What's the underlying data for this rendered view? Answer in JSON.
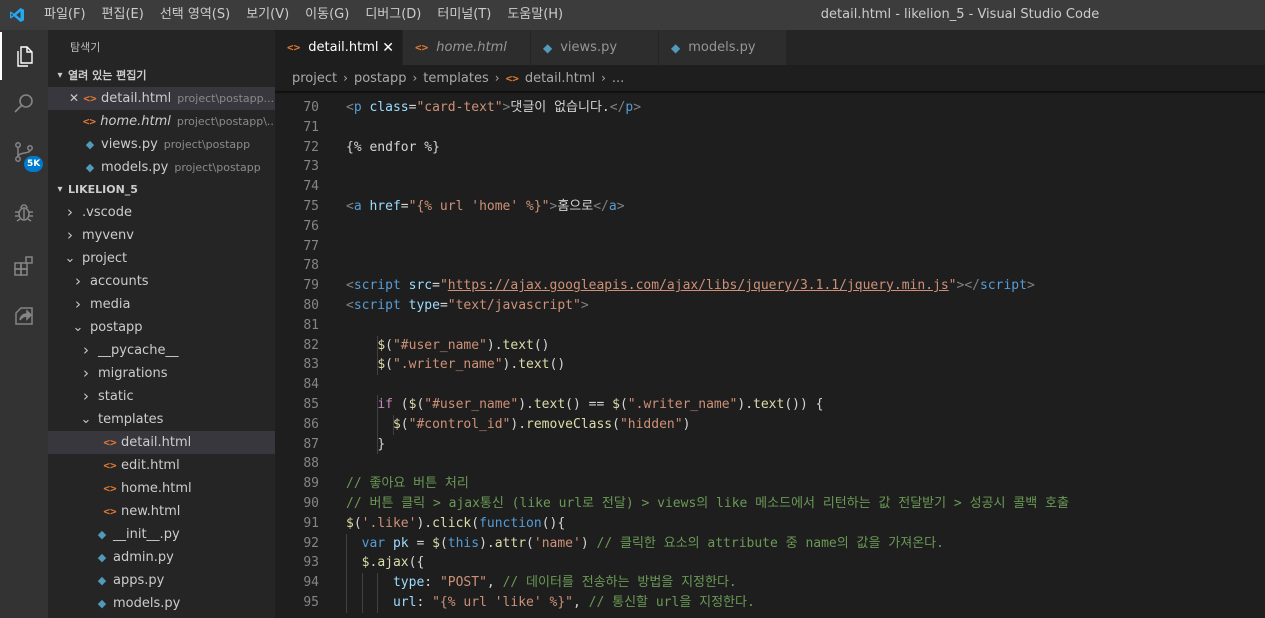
{
  "titlebar": {
    "menu": [
      "파일(F)",
      "편집(E)",
      "선택 영역(S)",
      "보기(V)",
      "이동(G)",
      "디버그(D)",
      "터미널(T)",
      "도움말(H)"
    ],
    "title": "detail.html - likelion_5 - Visual Studio Code"
  },
  "activity": {
    "scm_badge": "5K",
    "icons": [
      "explorer-icon",
      "search-icon",
      "source-control-icon",
      "debug-icon",
      "extensions-icon",
      "remote-explorer-icon"
    ]
  },
  "sidebar": {
    "title": "탐색기",
    "open_editors": {
      "header": "열려 있는 편집기",
      "items": [
        {
          "name": "detail.html",
          "path": "project\\postapp...",
          "type": "html",
          "italic": false,
          "selected": true
        },
        {
          "name": "home.html",
          "path": "project\\postapp\\...",
          "type": "html",
          "italic": true,
          "selected": false
        },
        {
          "name": "views.py",
          "path": "project\\postapp",
          "type": "py",
          "italic": false,
          "selected": false
        },
        {
          "name": "models.py",
          "path": "project\\postapp",
          "type": "py",
          "italic": false,
          "selected": false
        }
      ]
    },
    "workspace": {
      "header": "LIKELION_5",
      "tree": [
        {
          "name": ".vscode",
          "kind": "folder",
          "open": false,
          "depth": 0
        },
        {
          "name": "myvenv",
          "kind": "folder",
          "open": false,
          "depth": 0
        },
        {
          "name": "project",
          "kind": "folder",
          "open": true,
          "depth": 0
        },
        {
          "name": "accounts",
          "kind": "folder",
          "open": false,
          "depth": 1
        },
        {
          "name": "media",
          "kind": "folder",
          "open": false,
          "depth": 1
        },
        {
          "name": "postapp",
          "kind": "folder",
          "open": true,
          "depth": 1
        },
        {
          "name": "__pycache__",
          "kind": "folder",
          "open": false,
          "depth": 2
        },
        {
          "name": "migrations",
          "kind": "folder",
          "open": false,
          "depth": 2
        },
        {
          "name": "static",
          "kind": "folder",
          "open": false,
          "depth": 2
        },
        {
          "name": "templates",
          "kind": "folder",
          "open": true,
          "depth": 2
        },
        {
          "name": "detail.html",
          "kind": "html",
          "depth": 3,
          "selected": true
        },
        {
          "name": "edit.html",
          "kind": "html",
          "depth": 3
        },
        {
          "name": "home.html",
          "kind": "html",
          "depth": 3
        },
        {
          "name": "new.html",
          "kind": "html",
          "depth": 3
        },
        {
          "name": "__init__.py",
          "kind": "py",
          "depth": 2
        },
        {
          "name": "admin.py",
          "kind": "py",
          "depth": 2
        },
        {
          "name": "apps.py",
          "kind": "py",
          "depth": 2
        },
        {
          "name": "models.py",
          "kind": "py",
          "depth": 2
        }
      ]
    }
  },
  "tabs": [
    {
      "name": "detail.html",
      "type": "html",
      "active": true,
      "italic": false,
      "close": "✕"
    },
    {
      "name": "home.html",
      "type": "html",
      "active": false,
      "italic": true
    },
    {
      "name": "views.py",
      "type": "py",
      "active": false,
      "italic": false
    },
    {
      "name": "models.py",
      "type": "py",
      "active": false,
      "italic": false
    }
  ],
  "breadcrumbs": [
    "project",
    "postapp",
    "templates",
    "detail.html",
    "..."
  ],
  "editor": {
    "lines": [
      {
        "n": "70",
        "indent": 0,
        "tokens": [
          [
            "t-br",
            "<"
          ],
          [
            "t-tag",
            "p"
          ],
          [
            "t-txt",
            " "
          ],
          [
            "t-attr",
            "class"
          ],
          [
            "t-txt",
            "="
          ],
          [
            "t-str",
            "\"card-text\""
          ],
          [
            "t-br",
            ">"
          ],
          [
            "t-txt",
            "댓글이 없습니다."
          ],
          [
            "t-br",
            "</"
          ],
          [
            "t-tag",
            "p"
          ],
          [
            "t-br",
            ">"
          ]
        ]
      },
      {
        "n": "71",
        "indent": 0,
        "tokens": []
      },
      {
        "n": "72",
        "indent": 0,
        "tokens": [
          [
            "t-txt",
            "{% endfor %}"
          ]
        ]
      },
      {
        "n": "73",
        "indent": 0,
        "tokens": []
      },
      {
        "n": "74",
        "indent": 0,
        "tokens": []
      },
      {
        "n": "75",
        "indent": 0,
        "tokens": [
          [
            "t-br",
            "<"
          ],
          [
            "t-tag",
            "a"
          ],
          [
            "t-txt",
            " "
          ],
          [
            "t-attr",
            "href"
          ],
          [
            "t-txt",
            "="
          ],
          [
            "t-str",
            "\"{% url 'home' %}\""
          ],
          [
            "t-br",
            ">"
          ],
          [
            "t-txt",
            "홈으로"
          ],
          [
            "t-br",
            "</"
          ],
          [
            "t-tag",
            "a"
          ],
          [
            "t-br",
            ">"
          ]
        ]
      },
      {
        "n": "76",
        "indent": 0,
        "tokens": []
      },
      {
        "n": "77",
        "indent": 0,
        "tokens": []
      },
      {
        "n": "78",
        "indent": 0,
        "tokens": []
      },
      {
        "n": "79",
        "indent": 0,
        "tokens": [
          [
            "t-br",
            "<"
          ],
          [
            "t-tag",
            "script"
          ],
          [
            "t-txt",
            " "
          ],
          [
            "t-attr",
            "src"
          ],
          [
            "t-txt",
            "="
          ],
          [
            "t-str",
            "\""
          ],
          [
            "t-url",
            "https://ajax.googleapis.com/ajax/libs/jquery/3.1.1/jquery.min.js"
          ],
          [
            "t-str",
            "\""
          ],
          [
            "t-br",
            "></"
          ],
          [
            "t-tag",
            "script"
          ],
          [
            "t-br",
            ">"
          ]
        ]
      },
      {
        "n": "80",
        "indent": 0,
        "tokens": [
          [
            "t-br",
            "<"
          ],
          [
            "t-tag",
            "script"
          ],
          [
            "t-txt",
            " "
          ],
          [
            "t-attr",
            "type"
          ],
          [
            "t-txt",
            "="
          ],
          [
            "t-str",
            "\"text/javascript\""
          ],
          [
            "t-br",
            ">"
          ]
        ]
      },
      {
        "n": "81",
        "indent": 0,
        "tokens": []
      },
      {
        "n": "82",
        "indent": 4,
        "tokens": [
          [
            "t-fn",
            "$"
          ],
          [
            "t-txt",
            "("
          ],
          [
            "t-str",
            "\"#user_name\""
          ],
          [
            "t-txt",
            ")."
          ],
          [
            "t-fn",
            "text"
          ],
          [
            "t-txt",
            "()"
          ]
        ]
      },
      {
        "n": "83",
        "indent": 4,
        "tokens": [
          [
            "t-fn",
            "$"
          ],
          [
            "t-txt",
            "("
          ],
          [
            "t-str",
            "\".writer_name\""
          ],
          [
            "t-txt",
            ")."
          ],
          [
            "t-fn",
            "text"
          ],
          [
            "t-txt",
            "()"
          ]
        ]
      },
      {
        "n": "84",
        "indent": 0,
        "tokens": []
      },
      {
        "n": "85",
        "indent": 4,
        "tokens": [
          [
            "t-kw",
            "if"
          ],
          [
            "t-txt",
            " ("
          ],
          [
            "t-fn",
            "$"
          ],
          [
            "t-txt",
            "("
          ],
          [
            "t-str",
            "\"#user_name\""
          ],
          [
            "t-txt",
            ")."
          ],
          [
            "t-fn",
            "text"
          ],
          [
            "t-txt",
            "() == "
          ],
          [
            "t-fn",
            "$"
          ],
          [
            "t-txt",
            "("
          ],
          [
            "t-str",
            "\".writer_name\""
          ],
          [
            "t-txt",
            ")."
          ],
          [
            "t-fn",
            "text"
          ],
          [
            "t-txt",
            "()) {"
          ]
        ]
      },
      {
        "n": "86",
        "indent": 6,
        "tokens": [
          [
            "t-fn",
            "$"
          ],
          [
            "t-txt",
            "("
          ],
          [
            "t-str",
            "\"#control_id\""
          ],
          [
            "t-txt",
            ")."
          ],
          [
            "t-fn",
            "removeClass"
          ],
          [
            "t-txt",
            "("
          ],
          [
            "t-str",
            "\"hidden\""
          ],
          [
            "t-txt",
            ")"
          ]
        ]
      },
      {
        "n": "87",
        "indent": 4,
        "tokens": [
          [
            "t-txt",
            "}"
          ]
        ]
      },
      {
        "n": "88",
        "indent": 0,
        "tokens": []
      },
      {
        "n": "89",
        "indent": 0,
        "tokens": [
          [
            "t-com",
            "// 좋아요 버튼 처리"
          ]
        ]
      },
      {
        "n": "90",
        "indent": 0,
        "tokens": [
          [
            "t-com",
            "// 버튼 클릭 > ajax통신 (like url로 전달) > views의 like 메소드에서 리턴하는 값 전달받기 > 성공시 콜백 호출"
          ]
        ]
      },
      {
        "n": "91",
        "indent": 0,
        "tokens": [
          [
            "t-fn",
            "$"
          ],
          [
            "t-txt",
            "("
          ],
          [
            "t-str",
            "'.like'"
          ],
          [
            "t-txt",
            ")."
          ],
          [
            "t-fn",
            "click"
          ],
          [
            "t-txt",
            "("
          ],
          [
            "t-kwb",
            "function"
          ],
          [
            "t-txt",
            "(){"
          ]
        ]
      },
      {
        "n": "92",
        "indent": 2,
        "tokens": [
          [
            "t-kwb",
            "var"
          ],
          [
            "t-txt",
            " "
          ],
          [
            "t-attr",
            "pk"
          ],
          [
            "t-txt",
            " = "
          ],
          [
            "t-fn",
            "$"
          ],
          [
            "t-txt",
            "("
          ],
          [
            "t-kwb",
            "this"
          ],
          [
            "t-txt",
            ")."
          ],
          [
            "t-fn",
            "attr"
          ],
          [
            "t-txt",
            "("
          ],
          [
            "t-str",
            "'name'"
          ],
          [
            "t-txt",
            ") "
          ],
          [
            "t-com",
            "// 클릭한 요소의 attribute 중 name의 값을 가져온다."
          ]
        ]
      },
      {
        "n": "93",
        "indent": 2,
        "tokens": [
          [
            "t-fn",
            "$"
          ],
          [
            "t-txt",
            "."
          ],
          [
            "t-fn",
            "ajax"
          ],
          [
            "t-txt",
            "({"
          ]
        ]
      },
      {
        "n": "94",
        "indent": 6,
        "tokens": [
          [
            "t-attr",
            "type"
          ],
          [
            "t-txt",
            ": "
          ],
          [
            "t-str",
            "\"POST\""
          ],
          [
            "t-txt",
            ", "
          ],
          [
            "t-com",
            "// 데이터를 전송하는 방법을 지정한다."
          ]
        ]
      },
      {
        "n": "95",
        "indent": 6,
        "tokens": [
          [
            "t-attr",
            "url"
          ],
          [
            "t-txt",
            ": "
          ],
          [
            "t-str",
            "\"{% url 'like' %}\""
          ],
          [
            "t-txt",
            ", "
          ],
          [
            "t-com",
            "// 통신할 url을 지정한다."
          ]
        ]
      }
    ]
  }
}
